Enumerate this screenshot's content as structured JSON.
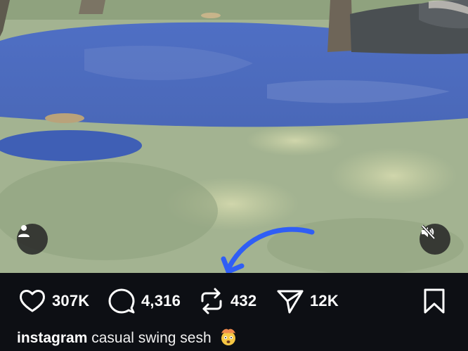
{
  "post": {
    "media_description_icon": "video-frame",
    "user_tag_icon": "person-icon",
    "mute_icon": "speaker-muted-icon"
  },
  "actions": {
    "likes": "307K",
    "comments": "4,316",
    "reposts": "432",
    "shares": "12K"
  },
  "caption": {
    "username": "instagram",
    "text": "casual swing sesh",
    "emoji": "exploding-head"
  },
  "colors": {
    "background": "#0d0f14",
    "annotation_arrow": "#2f5ef5",
    "text": "#ffffff"
  }
}
